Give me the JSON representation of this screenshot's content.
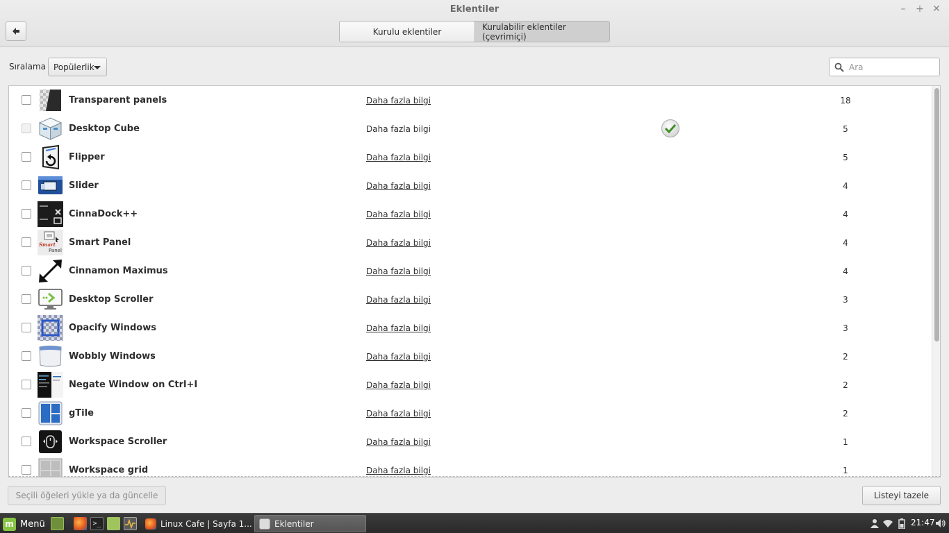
{
  "window": {
    "title": "Eklentiler",
    "tabs": [
      {
        "label": "Kurulu eklentiler",
        "active": false
      },
      {
        "label": "Kurulabilir eklentiler (çevrimiçi)",
        "active": true
      }
    ]
  },
  "toolbar": {
    "sort_label": "Sıralama",
    "sort_value": "Popülerlik",
    "search_placeholder": "Ara"
  },
  "extensions": [
    {
      "name": "Transparent panels",
      "info": "Daha fazla bilgi",
      "score": "18",
      "installed": false,
      "icon": "transparent-panels-icon"
    },
    {
      "name": "Desktop Cube",
      "info": "Daha fazla bilgi",
      "score": "5",
      "installed": true,
      "icon": "desktop-cube-icon"
    },
    {
      "name": "Flipper",
      "info": "Daha fazla bilgi",
      "score": "5",
      "installed": false,
      "icon": "flipper-icon"
    },
    {
      "name": "Slider",
      "info": "Daha fazla bilgi",
      "score": "4",
      "installed": false,
      "icon": "slider-icon"
    },
    {
      "name": "CinnaDock++",
      "info": "Daha fazla bilgi",
      "score": "4",
      "installed": false,
      "icon": "cinnadock-icon"
    },
    {
      "name": "Smart Panel",
      "info": "Daha fazla bilgi",
      "score": "4",
      "installed": false,
      "icon": "smart-panel-icon",
      "icon_text": "Smart Panel"
    },
    {
      "name": "Cinnamon Maximus",
      "info": "Daha fazla bilgi",
      "score": "4",
      "installed": false,
      "icon": "maximize-arrows-icon"
    },
    {
      "name": "Desktop Scroller",
      "info": "Daha fazla bilgi",
      "score": "3",
      "installed": false,
      "icon": "desktop-scroller-icon"
    },
    {
      "name": "Opacify Windows",
      "info": "Daha fazla bilgi",
      "score": "3",
      "installed": false,
      "icon": "opacify-windows-icon"
    },
    {
      "name": "Wobbly Windows",
      "info": "Daha fazla bilgi",
      "score": "2",
      "installed": false,
      "icon": "wobbly-windows-icon"
    },
    {
      "name": "Negate Window on Ctrl+I",
      "info": "Daha fazla bilgi",
      "score": "2",
      "installed": false,
      "icon": "negate-window-icon"
    },
    {
      "name": "gTile",
      "info": "Daha fazla bilgi",
      "score": "2",
      "installed": false,
      "icon": "gtile-icon"
    },
    {
      "name": "Workspace Scroller",
      "info": "Daha fazla bilgi",
      "score": "1",
      "installed": false,
      "icon": "workspace-scroller-icon"
    },
    {
      "name": "Workspace grid",
      "info": "Daha fazla bilgi",
      "score": "1",
      "installed": false,
      "icon": "workspace-grid-icon"
    }
  ],
  "footer": {
    "install_label": "Seçili öğeleri yükle ya da güncelle",
    "refresh_label": "Listeyi tazele"
  },
  "taskbar": {
    "menu_label": "Menü",
    "tasks": [
      {
        "label": "Linux Cafe | Sayfa 1...",
        "active": false
      },
      {
        "label": "Eklentiler",
        "active": true
      }
    ],
    "clock": "21:47"
  }
}
